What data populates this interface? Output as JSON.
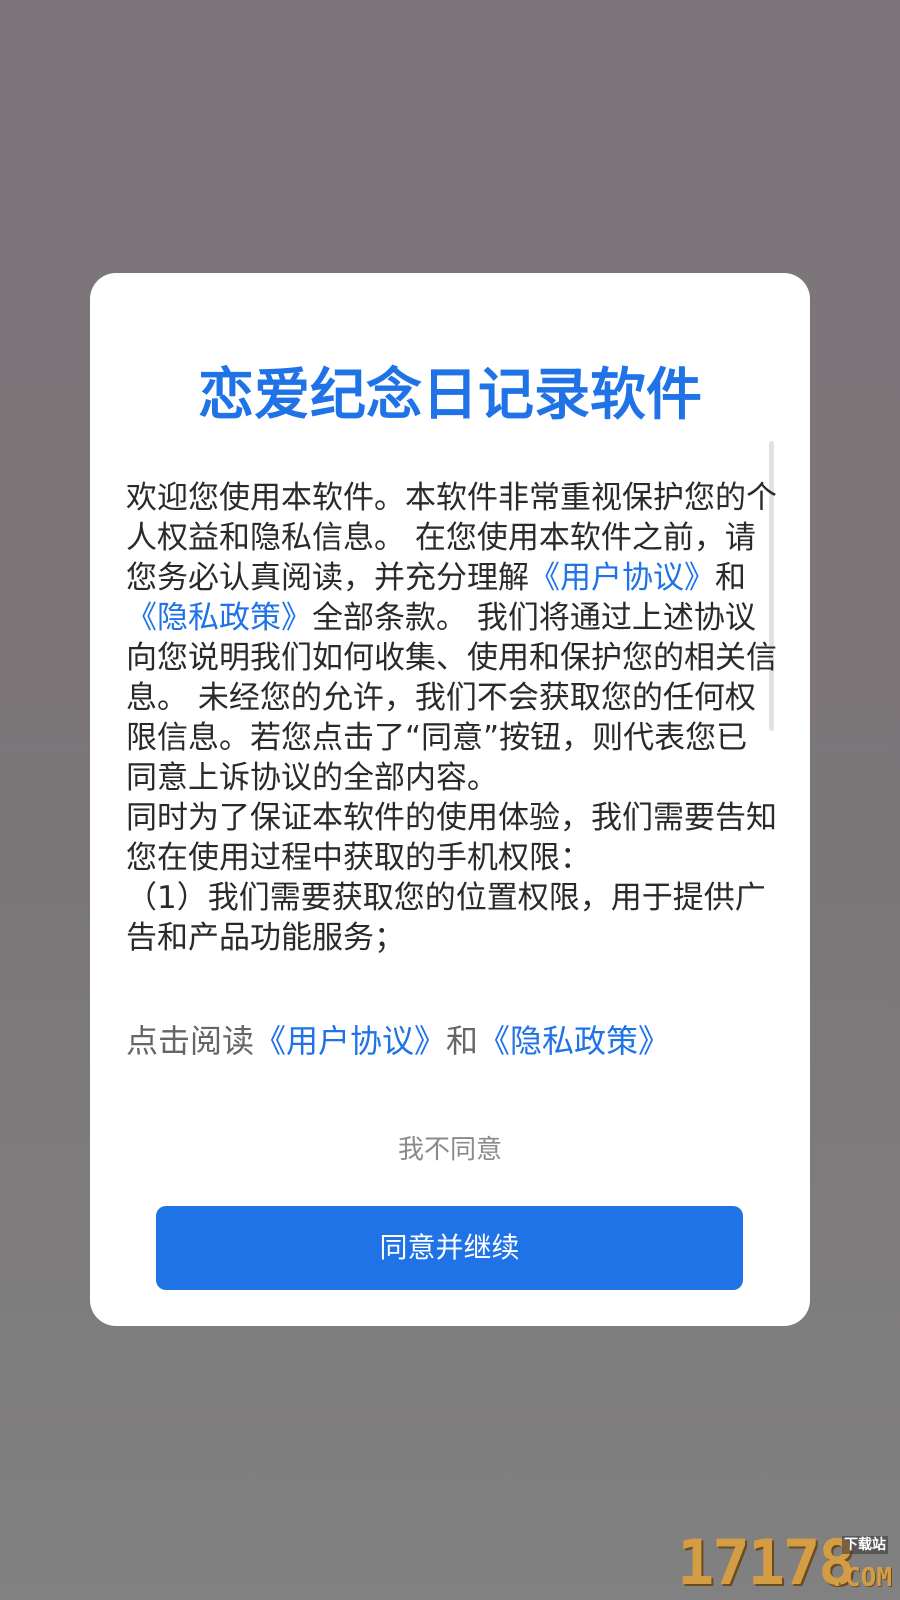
{
  "dialog": {
    "title": "恋爱纪念日记录软件",
    "body": {
      "part1": "欢迎您使用本软件。本软件非常重视保护您的个人权益和隐私信息。 在您使用本软件之前，请您务必认真阅读，并充分理解",
      "link_user_agreement": "《用户协议》",
      "and_text": "和",
      "link_privacy_policy": "《隐私政策》",
      "part2": "全部条款。 我们将通过上述协议向您说明我们如何收集、使用和保护您的相关信息。 未经您的允许，我们不会获取您的任何权限信息。若您点击了“同意”按钮，则代表您已同意上诉协议的全部内容。",
      "part3": " 同时为了保证本软件的使用体验，我们需要告知您在使用过程中获取的手机权限：",
      "part4": "（1）我们需要获取您的位置权限，用于提供广告和产品功能服务；"
    },
    "read_line": {
      "prefix": "点击阅读",
      "user_agreement": "《用户协议》",
      "and_text": "和",
      "privacy_policy": "《隐私政策》"
    },
    "disagree_label": "我不同意",
    "agree_label": "同意并继续"
  },
  "watermark": {
    "digits": "17178",
    "sub": "下载站",
    "com": ".COM"
  },
  "colors": {
    "accent": "#1f73e6",
    "overlay": "#7b7779"
  }
}
